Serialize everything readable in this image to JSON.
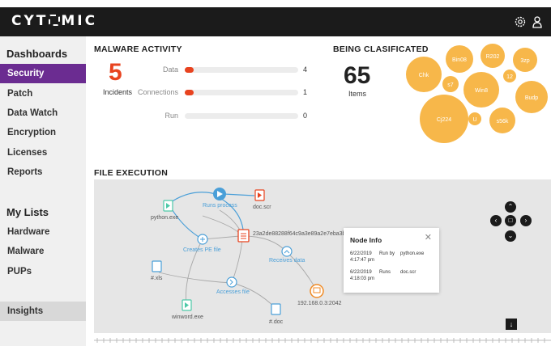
{
  "app": {
    "logo_text_left": "CYT",
    "logo_text_right": "MIC"
  },
  "topbar": {
    "icons": [
      "gear-icon",
      "user-icon"
    ]
  },
  "sidebar": {
    "dashboards_heading": "Dashboards",
    "items": [
      {
        "label": "Security",
        "active": true
      },
      {
        "label": "Patch"
      },
      {
        "label": "Data Watch"
      },
      {
        "label": "Encryption"
      },
      {
        "label": "Licenses"
      },
      {
        "label": "Reports"
      }
    ],
    "lists_heading": "My Lists",
    "list_items": [
      {
        "label": "Hardware"
      },
      {
        "label": "Malware"
      },
      {
        "label": "PUPs"
      }
    ],
    "insights_label": "Insights"
  },
  "malware_activity": {
    "title": "MALWARE ACTIVITY",
    "incidents_value": "5",
    "incidents_label": "Incidents",
    "rows": [
      {
        "label": "Data",
        "value": "4",
        "fill": 0.08
      },
      {
        "label": "Connections",
        "value": "1",
        "fill": 0.04
      },
      {
        "label": "Run",
        "value": "0",
        "fill": 0
      }
    ]
  },
  "being_classificated": {
    "title": "BEING CLASIFICATED",
    "items_value": "65",
    "items_label": "Items",
    "bubbles": [
      "Chk",
      "Bin08",
      "R202",
      "3zp",
      "s7",
      "12",
      "Win8",
      "Budp",
      "Cj224",
      "U",
      "s56k"
    ]
  },
  "file_execution": {
    "title": "FILE EXECUTION",
    "nodes": {
      "python": "python.exe",
      "doc_scr": "doc.scr",
      "hash": "23a2de88288f64c9a3e89a2e7eba3be",
      "xls": "#.xls",
      "receives": "Receives data",
      "ip": "192.168.0.3:2042",
      "winword": "winword.exe",
      "doc": "#.doc"
    },
    "edges": {
      "runs_process": "Runs process",
      "creates_pe": "Creates PE file",
      "accesses": "Accesses file"
    },
    "node_info": {
      "title": "Node Info",
      "rows": [
        {
          "date": "6/22/2019",
          "time": "4:17:47 pm",
          "action": "Run by",
          "target": "python.exe"
        },
        {
          "date": "6/22/2019",
          "time": "4:18:03 pm",
          "action": "Runs",
          "target": "doc.scr"
        }
      ]
    }
  },
  "colors": {
    "accent": "#6b2c91",
    "danger": "#e8431f",
    "bubble": "#f7b74a",
    "graph_blue": "#4a9fd8"
  }
}
